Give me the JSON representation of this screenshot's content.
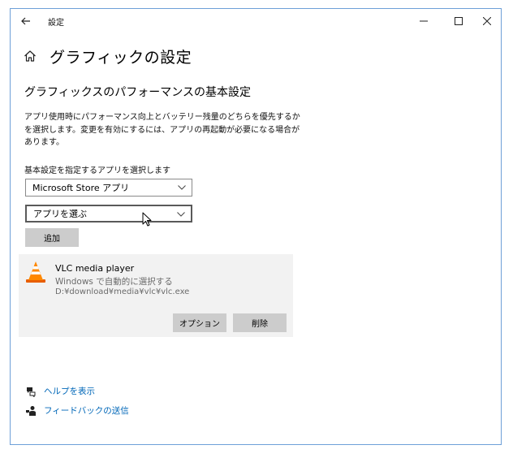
{
  "window": {
    "title": "設定"
  },
  "header": {
    "title": "グラフィックの設定"
  },
  "section": {
    "title": "グラフィックスのパフォーマンスの基本設定",
    "description": "アプリ使用時にパフォーマンス向上とバッテリー残量のどちらを優先するかを選択します。変更を有効にするには、アプリの再起動が必要になる場合があります。"
  },
  "selector": {
    "label": "基本設定を指定するアプリを選択します",
    "app_type_value": "Microsoft Store アプリ",
    "app_pick_value": "アプリを選ぶ",
    "add_label": "追加"
  },
  "app_entry": {
    "name": "VLC media player",
    "mode": "Windows で自動的に選択する",
    "path": "D:¥download¥media¥vlc¥vlc.exe",
    "options_label": "オプション",
    "remove_label": "削除"
  },
  "links": {
    "help": "ヘルプを表示",
    "feedback": "フィードバックの送信"
  },
  "colors": {
    "link": "#0067b8",
    "button": "#cccccc",
    "card": "#f2f2f2",
    "window_border": "#6ea0d8"
  }
}
